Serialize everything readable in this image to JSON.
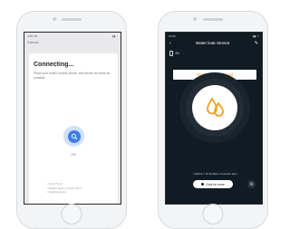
{
  "left_phone": {
    "status_time": "4:58 PM",
    "status_icons": "▮▮ ◔",
    "cancel_label": "Cancel",
    "title": "Connecting...",
    "description": "Place your router, mobile phone, and device as close as possible.",
    "progress_text": "0%",
    "steps": [
      "Device found",
      "Register device to Smart Cloud",
      "Initializing device"
    ]
  },
  "right_phone": {
    "status_time": "14:05",
    "status_icons": "▮▮ ▭",
    "title": "Water leak Sensor",
    "battery_text": "3%",
    "alert_text": "Notice water detected",
    "history_text": "• 2020-3-7 16:16 Water immersion alert",
    "more_label": "Click for more",
    "colors": {
      "alert": "#f0a020",
      "background": "#101b24"
    },
    "icons": [
      "back-arrow-icon",
      "edit-icon",
      "battery-icon",
      "water-drops-icon",
      "settings-icon"
    ]
  }
}
